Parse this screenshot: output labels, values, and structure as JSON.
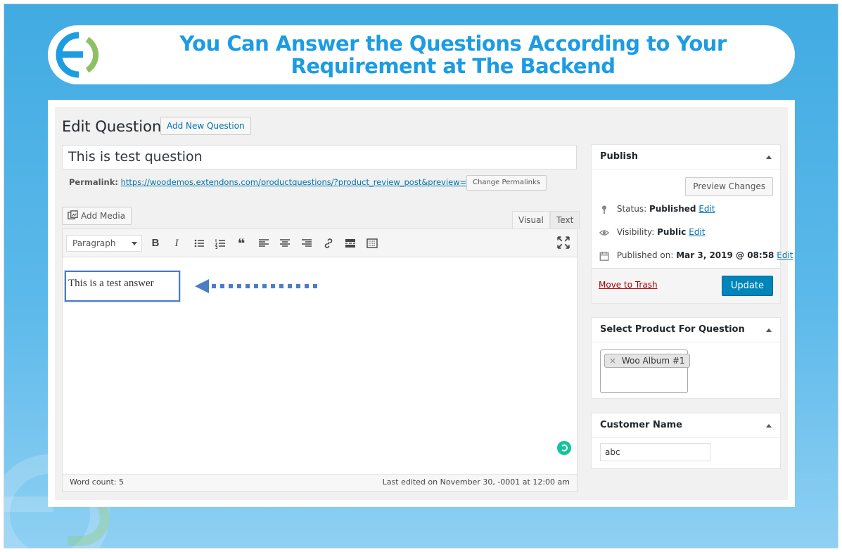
{
  "banner": {
    "title_line1": "You Can Answer the Questions According to Your",
    "title_line2": "Requirement at The Backend",
    "colors": {
      "title": "#1b9ce3",
      "background_top": "#41abe2",
      "logo_green": "#8cc063"
    }
  },
  "header": {
    "title": "Edit Question",
    "add_new_label": "Add New Question"
  },
  "post": {
    "title_value": "This is test question",
    "permalink_label": "Permalink:",
    "permalink_url": "https://woodemos.extendons.com/productquestions/?product_review_post&preview=true",
    "change_permalinks_label": "Change Permalinks"
  },
  "editor": {
    "add_media_label": "Add Media",
    "tabs": {
      "visual": "Visual",
      "text": "Text"
    },
    "format_select": "Paragraph",
    "toolbar_icons": [
      "bold-icon",
      "italic-icon",
      "bullet-list-icon",
      "numbered-list-icon",
      "blockquote-icon",
      "align-left-icon",
      "align-center-icon",
      "align-right-icon",
      "link-icon",
      "read-more-icon",
      "toolbar-toggle-icon",
      "fullscreen-icon"
    ],
    "content": "This is a test answer",
    "word_count": "Word count: 5",
    "last_edited": "Last edited on November 30, -0001 at 12:00 am"
  },
  "publish": {
    "title": "Publish",
    "preview_label": "Preview Changes",
    "status_label": "Status:",
    "status_value": "Published",
    "visibility_label": "Visibility:",
    "visibility_value": "Public",
    "published_label": "Published on:",
    "published_value": "Mar 3, 2019 @ 08:58",
    "edit_label": "Edit",
    "trash_label": "Move to Trash",
    "update_label": "Update",
    "colors": {
      "update": "#0085ba",
      "trash": "#aa0000",
      "link": "#0073aa"
    }
  },
  "product": {
    "title": "Select Product For Question",
    "tag_remove": "×",
    "tag_label": "Woo Album #1"
  },
  "customer": {
    "title": "Customer Name",
    "value": "abc"
  }
}
